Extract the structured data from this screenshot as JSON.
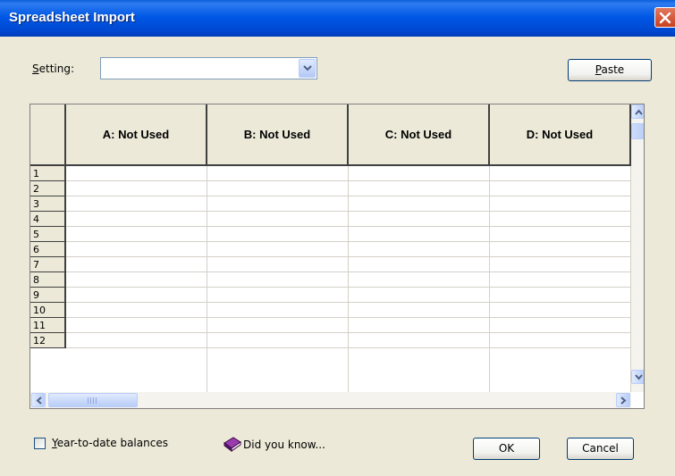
{
  "window": {
    "title": "Spreadsheet Import"
  },
  "setting": {
    "label_accel": "S",
    "label_rest": "etting:",
    "value": ""
  },
  "buttons": {
    "paste_accel": "P",
    "paste_rest": "aste",
    "ok": "OK",
    "cancel": "Cancel"
  },
  "grid": {
    "columns": [
      "A:  Not Used",
      "B:  Not Used",
      "C:  Not Used",
      "D:  Not Used"
    ],
    "rows": [
      "1",
      "2",
      "3",
      "4",
      "5",
      "6",
      "7",
      "8",
      "9",
      "10",
      "11",
      "12"
    ]
  },
  "options": {
    "ytd_accel": "Y",
    "ytd_rest": "ear-to-date balances",
    "ytd_checked": false,
    "did_you_know": "Did you know..."
  },
  "colors": {
    "titlebar": "#0058e6",
    "face": "#ece9d8",
    "book_icon": "#7a1f8a"
  }
}
